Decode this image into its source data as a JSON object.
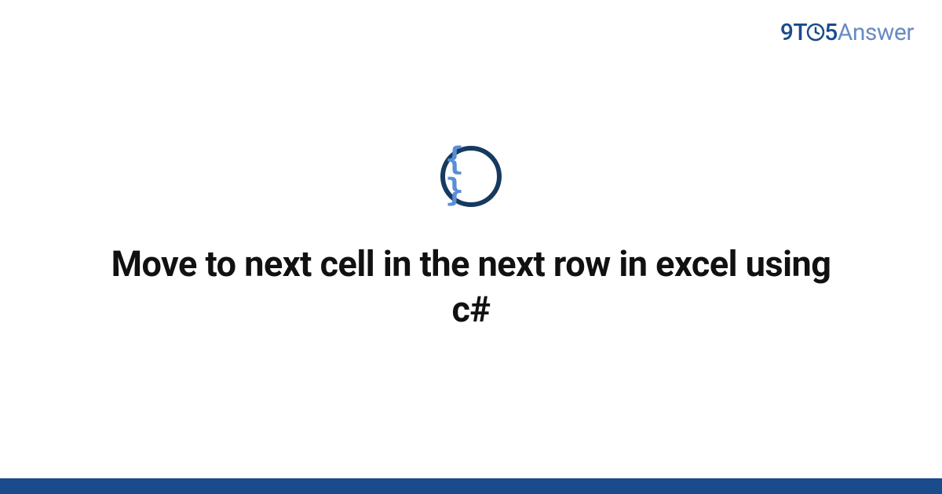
{
  "brand": {
    "nine": "9",
    "t": "T",
    "five": "5",
    "answer": "Answer"
  },
  "icon": {
    "symbol": "{ }",
    "name": "code-braces-icon"
  },
  "title": "Move to next cell in the next row in excel using c#",
  "colors": {
    "brand_dark": "#1a4b8c",
    "brand_light": "#6a8bc4",
    "icon_border": "#163a5f",
    "icon_glyph": "#5a8fd6",
    "text": "#111111"
  }
}
